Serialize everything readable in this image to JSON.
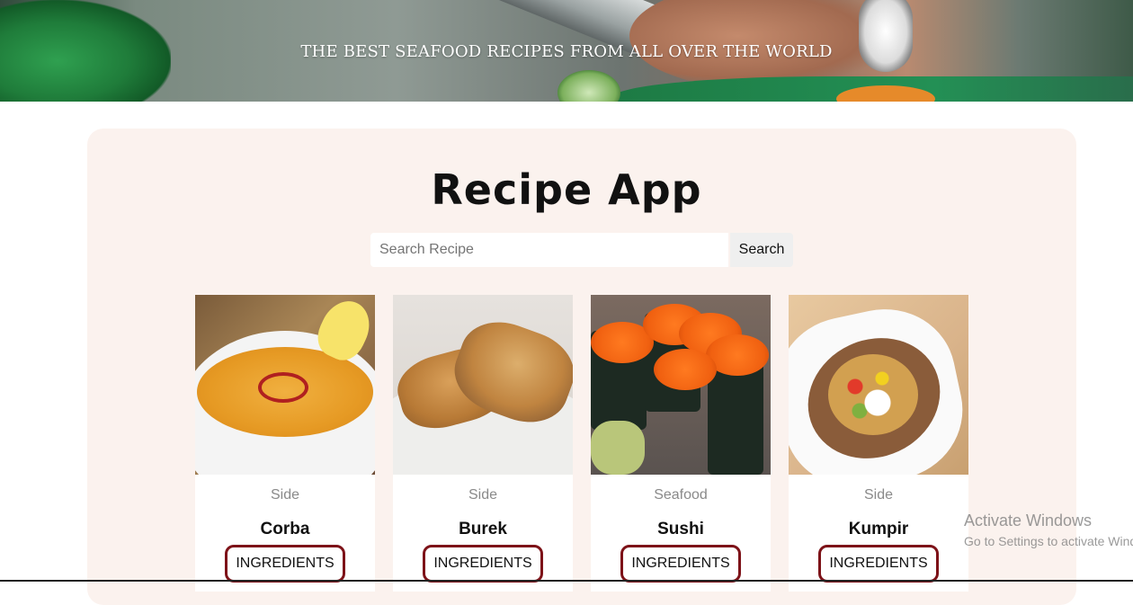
{
  "header": {
    "tagline": "THE BEST SEAFOOD RECIPES FROM ALL OVER THE WORLD"
  },
  "app": {
    "title": "Recipe App"
  },
  "search": {
    "placeholder": "Search Recipe",
    "value": "",
    "button_label": "Search"
  },
  "recipes": [
    {
      "category": "Side",
      "name": "Corba",
      "button_label": "INGREDIENTS"
    },
    {
      "category": "Side",
      "name": "Burek",
      "button_label": "INGREDIENTS"
    },
    {
      "category": "Seafood",
      "name": "Sushi",
      "button_label": "INGREDIENTS"
    },
    {
      "category": "Side",
      "name": "Kumpir",
      "button_label": "INGREDIENTS"
    }
  ],
  "watermark": {
    "line1": "Activate Windows",
    "line2": "Go to Settings to activate Windows."
  },
  "colors": {
    "panel_background": "#fbf2ee",
    "ingredients_border": "#7d1218"
  }
}
